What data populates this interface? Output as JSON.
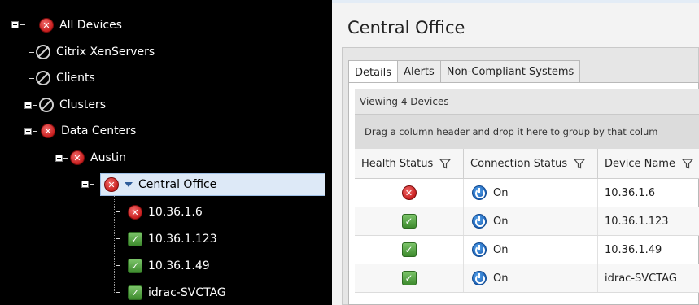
{
  "tree": {
    "root": {
      "label": "All Devices"
    },
    "items": [
      {
        "label": "Citrix XenServers"
      },
      {
        "label": "Clients"
      },
      {
        "label": "Clusters"
      },
      {
        "label": "Data Centers"
      }
    ],
    "austin": {
      "label": "Austin"
    },
    "central_office": {
      "label": "Central Office"
    },
    "devices": [
      {
        "label": "10.36.1.6"
      },
      {
        "label": "10.36.1.123"
      },
      {
        "label": "10.36.1.49"
      },
      {
        "label": "idrac-SVCTAG"
      }
    ]
  },
  "page": {
    "title": "Central Office"
  },
  "tabs": [
    {
      "label": "Details"
    },
    {
      "label": "Alerts"
    },
    {
      "label": "Non-Compliant Systems"
    }
  ],
  "grid": {
    "viewing": "Viewing 4 Devices",
    "group_hint": "Drag a column header and drop it here to group by that colum",
    "columns": [
      {
        "label": "Health Status"
      },
      {
        "label": "Connection Status"
      },
      {
        "label": "Device Name"
      }
    ],
    "rows": [
      {
        "health": "critical",
        "connection": "On",
        "device": "10.36.1.6"
      },
      {
        "health": "ok",
        "connection": "On",
        "device": "10.36.1.123"
      },
      {
        "health": "ok",
        "connection": "On",
        "device": "10.36.1.49"
      },
      {
        "health": "ok",
        "connection": "On",
        "device": "idrac-SVCTAG"
      }
    ]
  },
  "icons": {
    "critical": "error-x-icon",
    "ok": "check-icon",
    "unknown": "not-available-icon",
    "connection": "power-icon",
    "filter": "filter-funnel-icon"
  },
  "colors": {
    "critical": "#c81f1f",
    "ok": "#3d8a2d",
    "power": "#1a5fb4",
    "selection": "#dde9f7"
  }
}
